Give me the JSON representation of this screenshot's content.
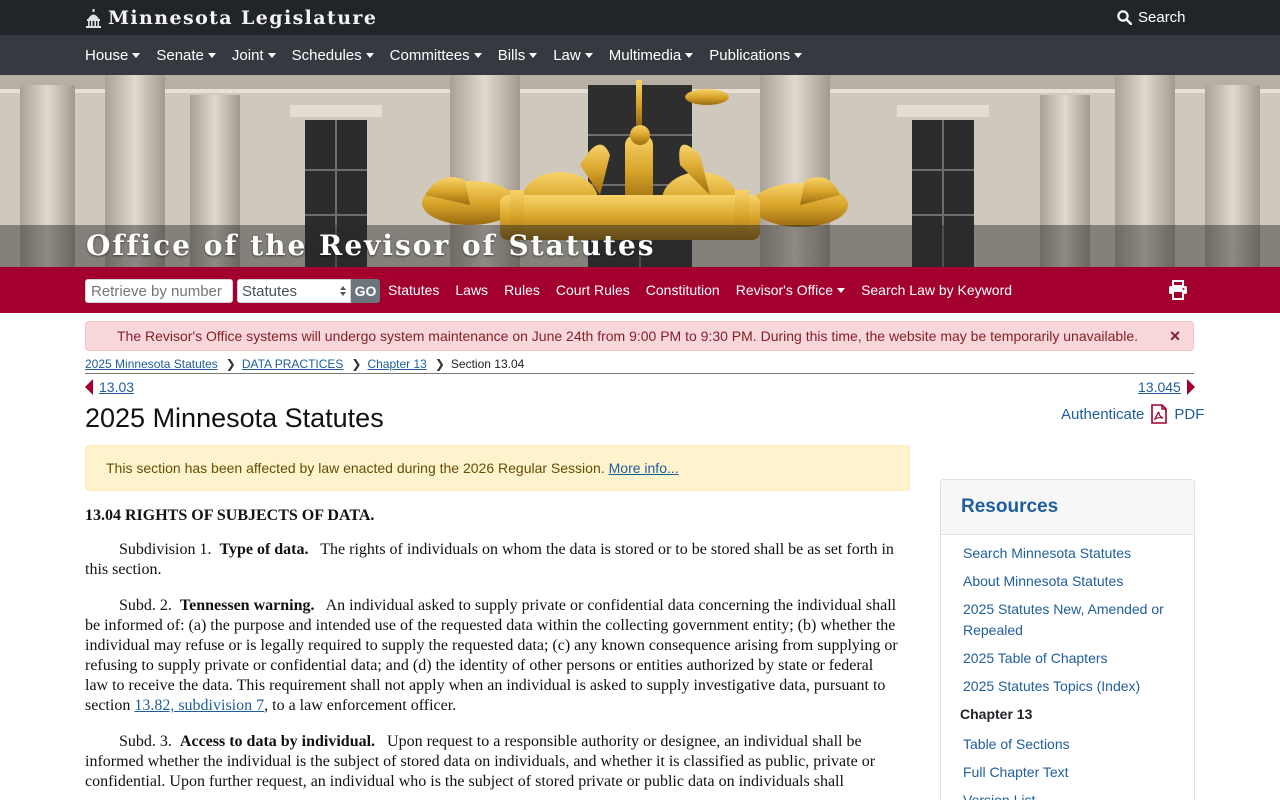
{
  "header": {
    "brand": "Minnesota Legislature",
    "search_label": "Search"
  },
  "main_nav": [
    "House",
    "Senate",
    "Joint",
    "Schedules",
    "Committees",
    "Bills",
    "Law",
    "Multimedia",
    "Publications"
  ],
  "banner": {
    "title": "Office of the Revisor of Statutes"
  },
  "revisor_nav": {
    "retrieve_placeholder": "Retrieve by number",
    "type_selected": "Statutes",
    "go_label": "GO",
    "links": [
      {
        "label": "Statutes",
        "dropdown": false
      },
      {
        "label": "Laws",
        "dropdown": false
      },
      {
        "label": "Rules",
        "dropdown": false
      },
      {
        "label": "Court Rules",
        "dropdown": false
      },
      {
        "label": "Constitution",
        "dropdown": false
      },
      {
        "label": "Revisor's Office",
        "dropdown": true
      },
      {
        "label": "Search Law by Keyword",
        "dropdown": false
      }
    ]
  },
  "alert": {
    "text": "The Revisor's Office systems will undergo system maintenance on June 24th from 9:00 PM to 9:30 PM. During this time, the website may be temporarily unavailable.",
    "close": "×"
  },
  "breadcrumb": {
    "items": [
      "2025 Minnesota Statutes",
      "DATA PRACTICES",
      "Chapter 13"
    ],
    "current": "Section 13.04"
  },
  "prev_section": "13.03",
  "next_section": "13.045",
  "page_title": "2025 Minnesota Statutes",
  "authenticate_label": "Authenticate",
  "pdf_label": "PDF",
  "notice": {
    "text": "This section has been affected by law enacted during the 2026 Regular Session.",
    "link": "More info..."
  },
  "statute": {
    "heading": "13.04 RIGHTS OF SUBJECTS OF DATA.",
    "subd1": {
      "label": "Subdivision 1.",
      "title": "Type of data.",
      "text": "The rights of individuals on whom the data is stored or to be stored shall be as set forth in this section."
    },
    "subd2": {
      "label": "Subd. 2.",
      "title": "Tennessen warning.",
      "text_before": "An individual asked to supply private or confidential data concerning the individual shall be informed of: (a) the purpose and intended use of the requested data within the collecting government entity; (b) whether the individual may refuse or is legally required to supply the requested data; (c) any known consequence arising from supplying or refusing to supply private or confidential data; and (d) the identity of other persons or entities authorized by state or federal law to receive the data. This requirement shall not apply when an individual is asked to supply investigative data, pursuant to section",
      "link": "13.82, subdivision 7",
      "text_after": ", to a law enforcement officer."
    },
    "subd3": {
      "label": "Subd. 3.",
      "title": "Access to data by individual.",
      "text": "Upon request to a responsible authority or designee, an individual shall be informed whether the individual is the subject of stored data on individuals, and whether it is classified as public, private or confidential. Upon further request, an individual who is the subject of stored private or public data on individuals shall"
    }
  },
  "sidebar": {
    "title": "Resources",
    "links": [
      "Search Minnesota Statutes",
      "About Minnesota Statutes",
      "2025 Statutes New, Amended or Repealed",
      "2025 Table of Chapters",
      "2025 Statutes Topics (Index)"
    ],
    "chapter_heading": "Chapter 13",
    "chapter_links": [
      "Table of Sections",
      "Full Chapter Text",
      "Version List"
    ]
  },
  "colors": {
    "top_bar": "#212529",
    "nav_bar": "#343a40",
    "revisor_bar": "#a3002e",
    "link": "#1f5e9c",
    "alert_bg": "#f8d7da",
    "notice_bg": "#fff3cd"
  }
}
